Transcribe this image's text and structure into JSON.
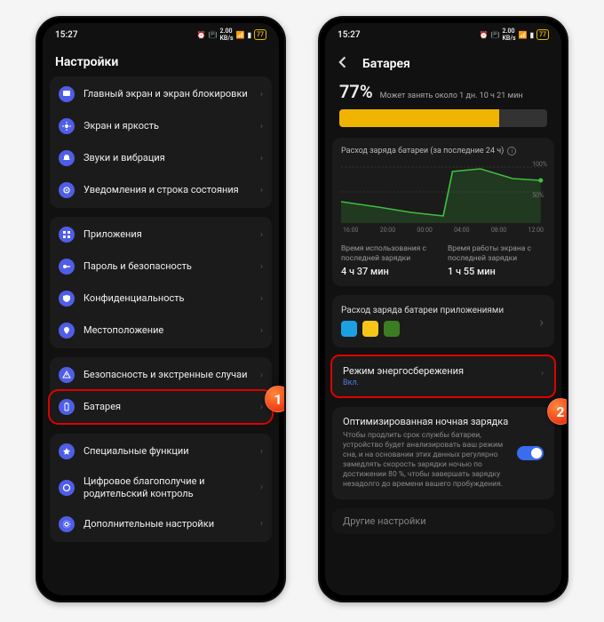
{
  "status": {
    "time": "15:27",
    "battery_pct": "77"
  },
  "screen1": {
    "title": "Настройки",
    "items": [
      {
        "label": "Главный экран и экран блокировки"
      },
      {
        "label": "Экран и яркость"
      },
      {
        "label": "Звуки и вибрация"
      },
      {
        "label": "Уведомления и строка состояния"
      }
    ],
    "items2": [
      {
        "label": "Приложения"
      },
      {
        "label": "Пароль и безопасность"
      },
      {
        "label": "Конфиденциальность"
      },
      {
        "label": "Местоположение"
      }
    ],
    "items3": [
      {
        "label": "Безопасность и экстренные случаи"
      },
      {
        "label": "Батарея",
        "highlight": true
      }
    ],
    "items4": [
      {
        "label": "Специальные функции"
      },
      {
        "label": "Цифровое благополучие и родительский контроль"
      },
      {
        "label": "Дополнительные настройки"
      }
    ]
  },
  "screen2": {
    "title": "Батарея",
    "pct": "77%",
    "eta": "Может занять около 1 дн. 10 ч 21 мин",
    "usage_card_title": "Расход заряда батареи (за последние 24 ч)",
    "axis_x": [
      "16:00",
      "20:00",
      "00:00",
      "04:00",
      "08:00",
      "12:00"
    ],
    "axis_y_top": "100%",
    "axis_y_bottom": "50%",
    "stat1_h": "Время использования с последней зарядки",
    "stat1_v": "4 ч 37 мин",
    "stat2_h": "Время работы экрана с последней зарядки",
    "stat2_v": "1 ч 55 мин",
    "app_usage_title": "Расход заряда батареи приложениями",
    "psm_title": "Режим энергосбережения",
    "psm_status": "Вкл.",
    "opt_title": "Оптимизированная ночная зарядка",
    "opt_desc": "Чтобы продлить срок службы батареи, устройство будет анализировать ваш режим сна, и на основании этих данных регулярно замедлять скорость зарядки ночью по достижении 80 %, чтобы завершать зарядку незадолго до времени вашего пробуждения.",
    "other": "Другие настройки"
  },
  "chart_data": {
    "type": "line",
    "title": "Расход заряда батареи (за последние 24 ч)",
    "xlabel": "",
    "ylabel": "",
    "ylim": [
      0,
      100
    ],
    "x": [
      "16:00",
      "20:00",
      "00:00",
      "04:00",
      "08:00",
      "12:00"
    ],
    "values": [
      38,
      30,
      22,
      17,
      90,
      95,
      80,
      77
    ]
  },
  "markers": {
    "m1": "1",
    "m2": "2"
  }
}
